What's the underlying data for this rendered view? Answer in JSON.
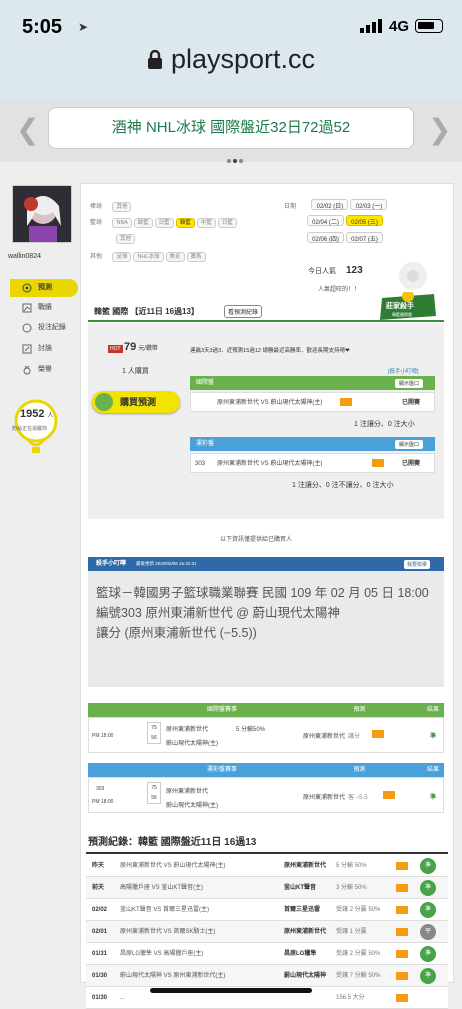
{
  "status": {
    "time": "5:05",
    "network": "4G"
  },
  "browser": {
    "url": "playsport.cc"
  },
  "header": {
    "title": "酒神 NHL冰球 國際盤近32日72過52"
  },
  "user": {
    "name": "wallin0824"
  },
  "menu": [
    "預測",
    "戰績",
    "投注紀錄",
    "討論",
    "榮譽"
  ],
  "fans": {
    "count": "1952",
    "unit": "人",
    "note": "粉絲正在追蹤你"
  },
  "filters": {
    "row1_label": "棒球",
    "row1": [
      "其他"
    ],
    "row2_label": "籃球",
    "row2": [
      "NBA",
      "歐籃",
      "日籃",
      "韓籃",
      "中籃",
      "日籃"
    ],
    "row2_extra": "其他",
    "row3_label": "其他",
    "row3": [
      "足球",
      "NHL冰球",
      "美足",
      "賽馬"
    ]
  },
  "dates": {
    "label": "日期",
    "items": [
      "02/02 (日)",
      "02/03 (一)",
      "02/04 (二)",
      "02/05 (三)",
      "02/06 (四)",
      "02/07 (五)"
    ]
  },
  "popularity": {
    "label": "今日人氣",
    "value": "123",
    "note": "人氣超旺的！！"
  },
  "sale": {
    "heading": "韓籃 國際 【近11日 16過13】",
    "history_btn": "看預測紀錄",
    "badge": "莊家殺手",
    "badge_sub": "韓籃國際盤",
    "price": "79",
    "price_unit": "元/鑽幣",
    "buyers": "1 人購買",
    "buy_btn": "購買預測",
    "streak": "連贏3天3過3．近預測15過12 總勝最近高勝率．歡迎長期支持唷❤",
    "link": "[殺手小叮嚀]"
  },
  "game_intl": {
    "label": "國際盤",
    "show": "顯示盤口",
    "row": "原州東浦新世代 VS 蔚山現代太陽神(主)",
    "status": "已開賽",
    "stats": "1 注讓分、0 注大小"
  },
  "game_local": {
    "label": "運彩盤",
    "show": "顯示盤口",
    "no": "303",
    "row": "原州東浦新世代 VS 蔚山現代太陽神(主)",
    "status": "已開賽",
    "stats": "1 注讓分、0 注不讓分、0 注大小"
  },
  "buyer_note": "以下資訊僅提供給已購買人",
  "tip": {
    "title": "殺手小叮嚀",
    "time": "最後更新 2020/02/06 15:42:31",
    "more": "我要檢舉",
    "line1": "籃球－韓國男子籃球職業聯賽 民國 109 年 02 月 05 日 18:00",
    "line2": "編號303 原州東浦新世代 @ 蔚山現代太陽神",
    "line3": "讓分 (原州東浦新世代 (−5.5))"
  },
  "intl_table": {
    "col1": "國際盤賽事",
    "col2": "預測",
    "col3": "結果",
    "time": "PM 18:00",
    "s1": "75",
    "s2": "56",
    "team1": "原州東浦新世代",
    "team2": "蔚山現代太陽神(主)",
    "handicap": "5 分輸50%",
    "pick": "原州東浦新世代",
    "pick_type": "讓分",
    "result": "準"
  },
  "local_table": {
    "col1": "運彩盤賽事",
    "col2": "預測",
    "col3": "結果",
    "no": "303",
    "time": "PM 18:00",
    "s1": "75",
    "s2": "56",
    "team1": "原州東浦新世代",
    "team2": "蔚山現代太陽神(主)",
    "pick": "原州東浦新世代",
    "pick_type": "客 −5.5",
    "result": "準"
  },
  "records": {
    "title": "預測紀錄：韓籃 國際盤近11日 16過13",
    "rows": [
      {
        "date": "昨天",
        "match": "原州東浦新世代 VS 蔚山現代太陽神(主)",
        "pick": "原州東浦新世代",
        "detail": "5 分輸 50%",
        "res": "準"
      },
      {
        "date": "前天",
        "match": "高陽獵戶座 VS 釜山KT聲音(主)",
        "pick": "釜山KT聲音",
        "detail": "3 分輸 50%",
        "res": "準"
      },
      {
        "date": "02/02",
        "match": "釜山KT聲音 VS 首爾三星迅雷(主)",
        "pick": "首爾三星迅雷",
        "detail": "受讓 2 分贏 50%",
        "res": "準"
      },
      {
        "date": "02/01",
        "match": "原州東浦新世代 VS 首爾SK騎士(主)",
        "pick": "原州東浦新世代",
        "detail": "受讓 1 分贏",
        "res": "平"
      },
      {
        "date": "01/31",
        "match": "昌原LG獵隼 VS 高陽獵戶座(主)",
        "pick": "昌原LG獵隼",
        "detail": "受讓 2 分贏 50%",
        "res": "準"
      },
      {
        "date": "01/30",
        "match": "蔚山現代太陽神 VS 原州東浦新世代(主)",
        "pick": "蔚山現代太陽神",
        "detail": "受讓 7 分輸 50%",
        "res": "準"
      },
      {
        "date": "01/30",
        "match": "...",
        "pick": "",
        "detail": "156.5 大分",
        "res": ""
      }
    ]
  }
}
